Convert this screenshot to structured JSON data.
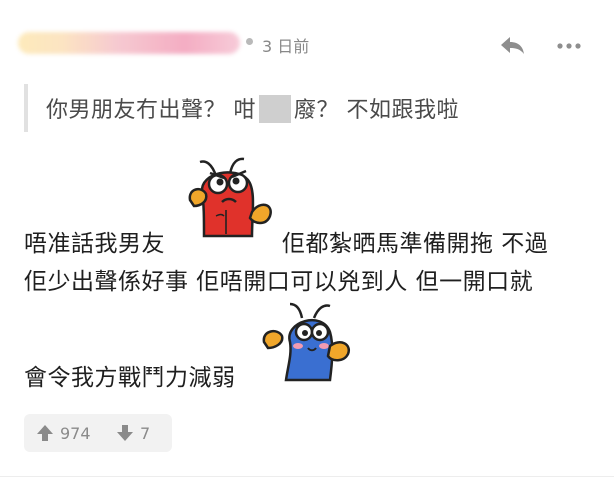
{
  "post": {
    "time_label": "3 日前",
    "quote": {
      "before_censor": "你男朋友冇出聲？ 咁",
      "after_censor": "廢？ 不如跟我啦"
    },
    "lines": {
      "line1_a": "唔准話我男友",
      "line1_b": "佢都紮晒馬準備開拖 不過",
      "line2": "佢少出聲係好事 佢唔開口可以兇到人 但一開口就",
      "line3": "會令我方戰鬥力減弱"
    },
    "votes": {
      "up_count": "974",
      "down_count": "7"
    }
  },
  "icons": {
    "reply": "reply-arrow-icon",
    "more": "more-dots-icon",
    "sticker_red": "red-lobster-sticker",
    "sticker_blue": "blue-lobster-sticker",
    "upvote": "arrow-up-icon",
    "downvote": "arrow-down-icon"
  },
  "colors": {
    "sticker_red": "#e0322b",
    "sticker_blue": "#3a6fd1",
    "sticker_claw": "#f0a62a"
  }
}
